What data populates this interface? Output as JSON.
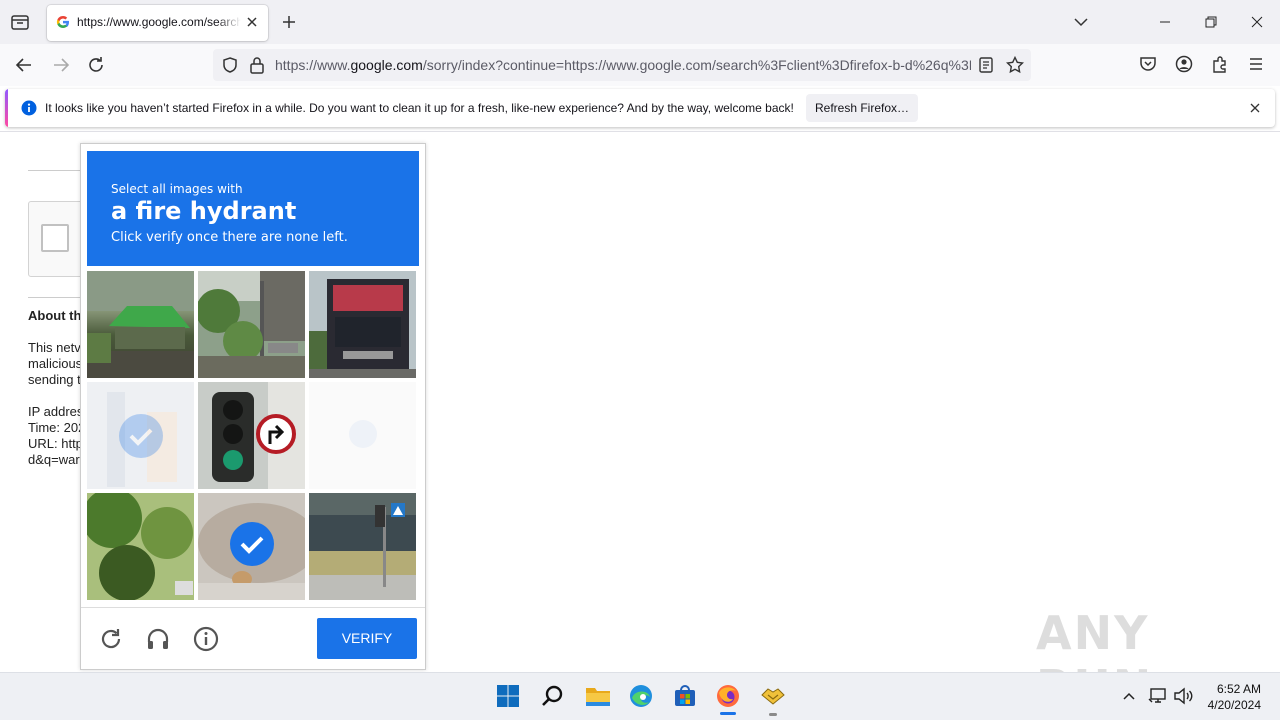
{
  "browser": {
    "tab": {
      "title": "https://www.google.com/search?client=firefox"
    },
    "url": {
      "prefix": "https://www.",
      "host": "google.com",
      "path": "/sorry/index?continue=https://www.google.com/search%3Fclient%3Dfirefox-b-d%26q%3D"
    },
    "notification": {
      "message": "It looks like you haven’t started Firefox in a while. Do you want to clean it up for a fresh, like-new experience? And by the way, welcome back!",
      "button_label": "Refresh Firefox…"
    }
  },
  "page": {
    "about_heading": "About th",
    "body_lines": [
      "This netv",
      "malicious",
      "sending t"
    ],
    "details_lines": [
      "IP addres",
      "Time: 202",
      "URL: http",
      "d&q=war"
    ]
  },
  "captcha": {
    "instruction_small": "Select all images with",
    "target": "a fire hydrant",
    "instruction_sub": "Click verify once there are none left.",
    "verify_label": "VERIFY",
    "tiles": [
      {
        "subject": "green tent",
        "selected": false,
        "faded": false
      },
      {
        "subject": "street with plants",
        "selected": false,
        "faded": false
      },
      {
        "subject": "truck",
        "selected": false,
        "faded": false
      },
      {
        "subject": "faded image",
        "selected": true,
        "faded": true
      },
      {
        "subject": "traffic light",
        "selected": false,
        "faded": false
      },
      {
        "subject": "blank",
        "selected": false,
        "faded": true
      },
      {
        "subject": "trees",
        "selected": false,
        "faded": false
      },
      {
        "subject": "fire hydrant",
        "selected": true,
        "faded": false
      },
      {
        "subject": "street crossing",
        "selected": false,
        "faded": false
      }
    ]
  },
  "taskbar": {
    "time": "6:52 AM",
    "date": "4/20/2024",
    "apps": [
      "start-icon",
      "search-icon",
      "file-explorer-icon",
      "edge-icon",
      "store-icon",
      "firefox-icon",
      "handshake-app-icon"
    ]
  },
  "watermark": "ANY RUN",
  "colors": {
    "accent": "#1a73e8",
    "chrome_bg": "#f0f0f4",
    "taskbar_bg": "#eef0f4"
  }
}
